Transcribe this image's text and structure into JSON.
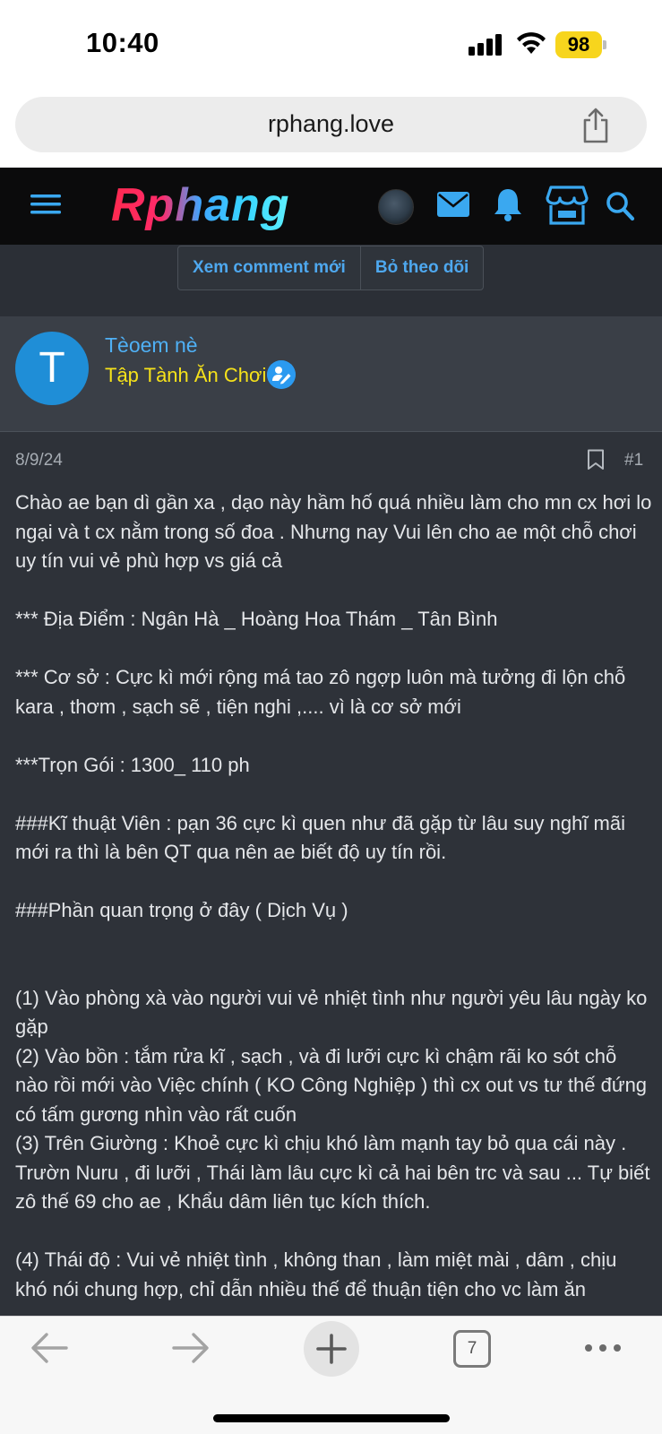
{
  "status_bar": {
    "time": "10:40",
    "battery": "98",
    "signal_icon": "cellular-signal-icon",
    "wifi_icon": "wifi-icon"
  },
  "browser": {
    "url": "rphang.love",
    "share_icon": "share-icon",
    "toolbar": {
      "back_icon": "back-arrow-icon",
      "forward_icon": "forward-arrow-icon",
      "new_tab_icon": "plus-icon",
      "tab_count": "7",
      "more_icon": "more-dots-icon"
    }
  },
  "site": {
    "logo_text": "Rphang",
    "header_icons": [
      "menu-icon",
      "avatar",
      "mail-icon",
      "bell-icon",
      "store-icon",
      "search-icon"
    ],
    "actions": {
      "new_comments": "Xem comment mới",
      "unfollow": "Bỏ theo dõi"
    }
  },
  "post": {
    "author": {
      "initial": "T",
      "name": "Tèoem nè",
      "title": "Tập Tành Ăn Chơi"
    },
    "date": "8/9/24",
    "number": "#1",
    "body": "Chào ae bạn dì gần xa , dạo này hầm hố quá nhiều làm cho mn cx hơi lo ngại và t cx nằm trong số đoa . Nhưng nay Vui lên cho ae một chỗ chơi uy tín vui vẻ phù hợp vs giá cả\n\n*** Địa Điểm : Ngân Hà _ Hoàng Hoa Thám _ Tân Bình\n\n*** Cơ sở : Cực kì mới rộng má tao zô ngợp luôn mà tưởng đi lộn chỗ kara , thơm , sạch sẽ , tiện nghi ,.... vì là cơ sở mới\n\n***Trọn Gói : 1300_ 110 ph\n\n###Kĩ thuật Viên : pạn 36 cực kì quen như đã gặp từ lâu suy nghĩ mãi mới ra thì là bên QT qua nên ae biết độ uy tín rồi.\n\n###Phần quan trọng ở đây ( Dịch Vụ )\n\n\n(1) Vào phòng xà vào người vui vẻ nhiệt tình như người yêu lâu ngày ko gặp\n(2) Vào bồn : tắm rửa kĩ , sạch , và đi lưỡi cực kì chậm rãi ko sót chỗ nào rồi mới vào Việc chính ( KO Công Nghiệp ) thì cx out vs tư thế đứng có tấm gương nhìn vào rất cuốn\n(3) Trên Giường : Khoẻ cực kì chịu khó làm mạnh tay bỏ qua cái này . Trườn Nuru , đi lưỡi , Thái làm lâu cực kì cả hai bên trc và sau ... Tự biết zô thế 69 cho ae , Khẩu dâm liên tục kích thích.\n\n(4) Thái độ : Vui vẻ nhiệt tình , không than , làm miệt mài , dâm , chịu khó nói chung hợp, chỉ dẫn nhiều thế để thuận tiện cho vc làm ăn"
  },
  "colors": {
    "header_bg": "#0b0b0c",
    "post_bg": "#2e3239",
    "link_blue": "#4ea8ef",
    "title_yellow": "#f6e21a",
    "battery_yellow": "#f7d51d"
  }
}
